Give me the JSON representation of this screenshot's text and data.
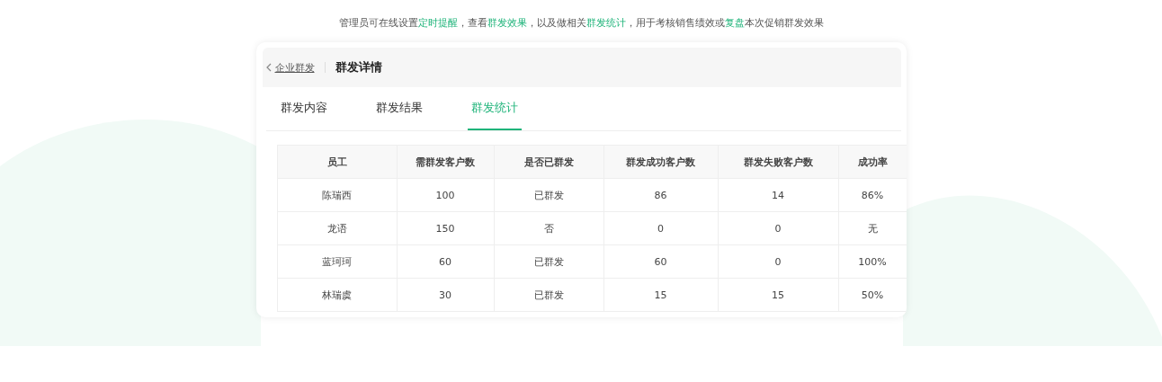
{
  "caption": [
    {
      "text": "管理员可在线设置",
      "highlight": false
    },
    {
      "text": "定时提醒",
      "highlight": true
    },
    {
      "text": "，查看",
      "highlight": false
    },
    {
      "text": "群发效果",
      "highlight": true
    },
    {
      "text": "，以及做相关",
      "highlight": false
    },
    {
      "text": "群发统计",
      "highlight": true
    },
    {
      "text": "，用于考核销售绩效或",
      "highlight": false
    },
    {
      "text": "复盘",
      "highlight": true
    },
    {
      "text": "本次促销群发效果",
      "highlight": false
    }
  ],
  "header": {
    "back_link": "企业群发",
    "title": "群发详情"
  },
  "tabs": [
    {
      "label": "群发内容",
      "selected": false
    },
    {
      "label": "群发结果",
      "selected": false
    },
    {
      "label": "群发统计",
      "selected": true
    }
  ],
  "table": {
    "columns": [
      "员工",
      "需群发客户数",
      "是否已群发",
      "群发成功客户数",
      "群发失败客户数",
      "成功率"
    ],
    "rows": [
      [
        "陈瑞西",
        "100",
        "已群发",
        "86",
        "14",
        "86%"
      ],
      [
        "龙语",
        "150",
        "否",
        "0",
        "0",
        "无"
      ],
      [
        "蓝珂珂",
        "60",
        "已群发",
        "60",
        "0",
        "100%"
      ],
      [
        "林瑞虞",
        "30",
        "已群发",
        "15",
        "15",
        "50%"
      ]
    ]
  }
}
